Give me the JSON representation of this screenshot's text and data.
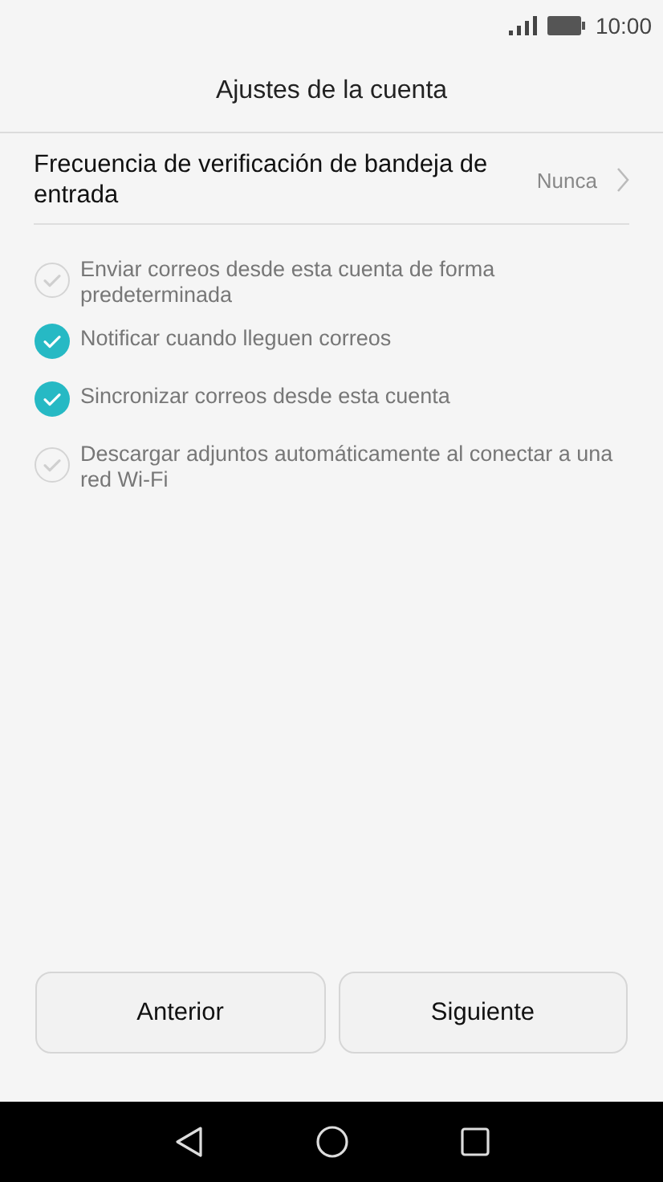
{
  "status_bar": {
    "time": "10:00"
  },
  "header": {
    "title": "Ajustes de la cuenta"
  },
  "setting": {
    "label": "Frecuencia de verificación de bandeja de entrada",
    "value": "Nunca"
  },
  "options": [
    {
      "label": "Enviar correos desde esta cuenta de forma predeterminada",
      "checked": false
    },
    {
      "label": "Notificar cuando lleguen correos",
      "checked": true
    },
    {
      "label": "Sincronizar correos desde esta cuenta",
      "checked": true
    },
    {
      "label": "Descargar adjuntos automáticamente al conectar a una red Wi-Fi",
      "checked": false
    }
  ],
  "buttons": [
    "Anterior",
    "Siguiente"
  ]
}
